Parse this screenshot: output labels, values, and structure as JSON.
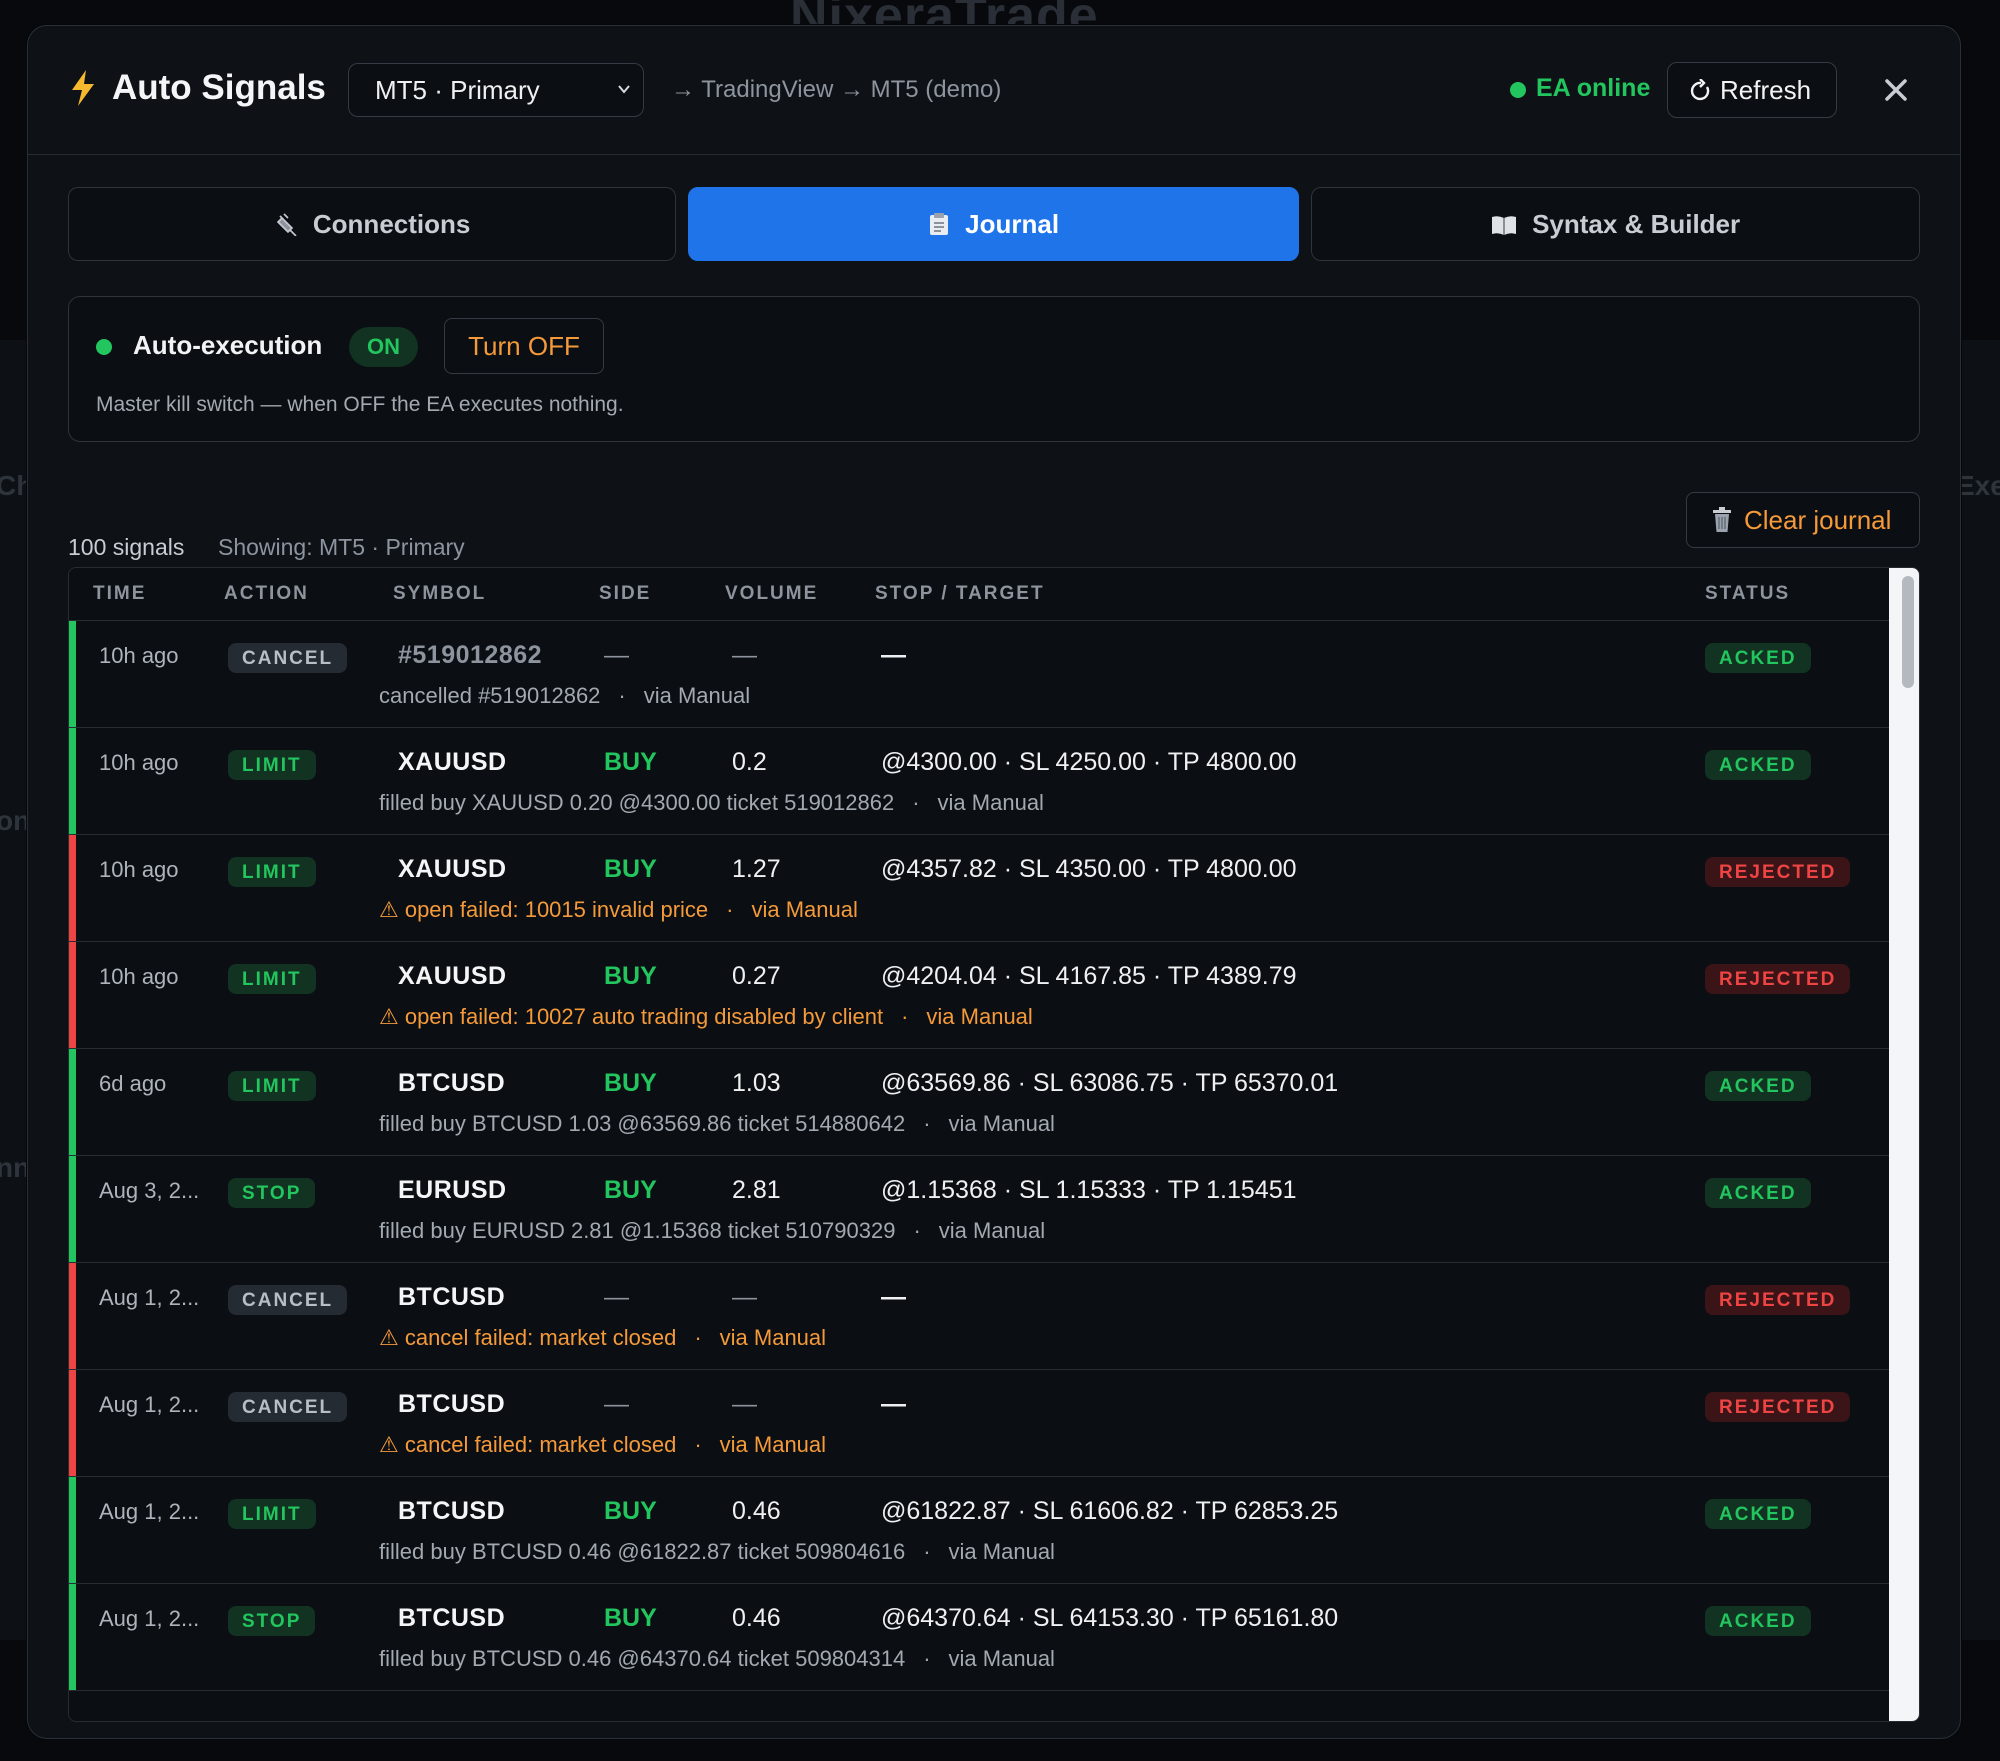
{
  "background": {
    "brand": "NixeraTrade",
    "fragments": [
      "Ch",
      "on",
      "nn",
      "Exe"
    ]
  },
  "header": {
    "title": "Auto Signals",
    "account_select": "MT5 · Primary",
    "route": "→ TradingView → MT5 (demo)",
    "ea_status": "EA online",
    "refresh_label": "Refresh"
  },
  "tabs": [
    {
      "label": "Connections",
      "icon": "plug-icon"
    },
    {
      "label": "Journal",
      "icon": "clipboard-icon",
      "active": true
    },
    {
      "label": "Syntax & Builder",
      "icon": "book-icon"
    }
  ],
  "auto_execution": {
    "label": "Auto-execution",
    "state": "ON",
    "toggle_label": "Turn OFF",
    "description": "Master kill switch — when OFF the EA executes nothing."
  },
  "journal": {
    "count": "100 signals",
    "showing": "Showing: MT5 · Primary",
    "clear_label": "Clear journal",
    "columns": [
      "TIME",
      "ACTION",
      "SYMBOL",
      "SIDE",
      "VOLUME",
      "STOP / TARGET",
      "STATUS"
    ],
    "rows": [
      {
        "time": "10h ago",
        "action": "CANCEL",
        "symbol": "#519012862",
        "side": "—",
        "volume": "—",
        "stop": "—",
        "detail": "cancelled #519012862",
        "via": "via Manual",
        "status": "ACKED",
        "error": false
      },
      {
        "time": "10h ago",
        "action": "LIMIT",
        "symbol": "XAUUSD",
        "side": "BUY",
        "volume": "0.2",
        "stop": "@4300.00 · SL 4250.00 · TP 4800.00",
        "detail": "filled buy XAUUSD 0.20 @4300.00 ticket 519012862",
        "via": "via Manual",
        "status": "ACKED",
        "error": false
      },
      {
        "time": "10h ago",
        "action": "LIMIT",
        "symbol": "XAUUSD",
        "side": "BUY",
        "volume": "1.27",
        "stop": "@4357.82 · SL 4350.00 · TP 4800.00",
        "detail": "⚠ open failed: 10015 invalid price",
        "via": "via Manual",
        "status": "REJECTED",
        "error": true
      },
      {
        "time": "10h ago",
        "action": "LIMIT",
        "symbol": "XAUUSD",
        "side": "BUY",
        "volume": "0.27",
        "stop": "@4204.04 · SL 4167.85 · TP 4389.79",
        "detail": "⚠ open failed: 10027 auto trading disabled by client",
        "via": "via Manual",
        "status": "REJECTED",
        "error": true
      },
      {
        "time": "6d ago",
        "action": "LIMIT",
        "symbol": "BTCUSD",
        "side": "BUY",
        "volume": "1.03",
        "stop": "@63569.86 · SL 63086.75 · TP 65370.01",
        "detail": "filled buy BTCUSD 1.03 @63569.86 ticket 514880642",
        "via": "via Manual",
        "status": "ACKED",
        "error": false
      },
      {
        "time": "Aug 3, 2...",
        "action": "STOP",
        "symbol": "EURUSD",
        "side": "BUY",
        "volume": "2.81",
        "stop": "@1.15368 · SL 1.15333 · TP 1.15451",
        "detail": "filled buy EURUSD 2.81 @1.15368 ticket 510790329",
        "via": "via Manual",
        "status": "ACKED",
        "error": false
      },
      {
        "time": "Aug 1, 2...",
        "action": "CANCEL",
        "symbol": "BTCUSD",
        "side": "—",
        "volume": "—",
        "stop": "—",
        "detail": "⚠ cancel failed: market closed",
        "via": "via Manual",
        "status": "REJECTED",
        "error": true
      },
      {
        "time": "Aug 1, 2...",
        "action": "CANCEL",
        "symbol": "BTCUSD",
        "side": "—",
        "volume": "—",
        "stop": "—",
        "detail": "⚠ cancel failed: market closed",
        "via": "via Manual",
        "status": "REJECTED",
        "error": true
      },
      {
        "time": "Aug 1, 2...",
        "action": "LIMIT",
        "symbol": "BTCUSD",
        "side": "BUY",
        "volume": "0.46",
        "stop": "@61822.87 · SL 61606.82 · TP 62853.25",
        "detail": "filled buy BTCUSD 0.46 @61822.87 ticket 509804616",
        "via": "via Manual",
        "status": "ACKED",
        "error": false
      },
      {
        "time": "Aug 1, 2...",
        "action": "STOP",
        "symbol": "BTCUSD",
        "side": "BUY",
        "volume": "0.46",
        "stop": "@64370.64 · SL 64153.30 · TP 65161.80",
        "detail": "filled buy BTCUSD 0.46 @64370.64 ticket 509804314",
        "via": "via Manual",
        "status": "ACKED",
        "error": false
      }
    ]
  },
  "colors": {
    "accent": "#1f74ea",
    "success": "#22c55e",
    "danger": "#ef4444",
    "warning": "#f59a3a"
  }
}
